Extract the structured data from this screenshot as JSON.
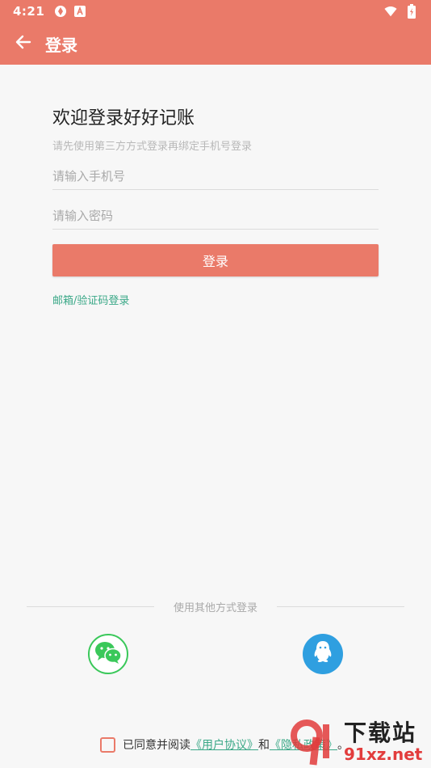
{
  "status_bar": {
    "time": "4:21",
    "left_icons": [
      "sync-icon",
      "font-a-icon"
    ],
    "right_icons": [
      "wifi-icon",
      "battery-icon"
    ]
  },
  "app_bar": {
    "back_icon": "arrow-left-icon",
    "title": "登录",
    "color": "#ea7a69"
  },
  "main": {
    "welcome_title": "欢迎登录好好记账",
    "welcome_subtitle": "请先使用第三方方式登录再绑定手机号登录",
    "phone_placeholder": "请输入手机号",
    "password_placeholder": "请输入密码",
    "login_button": "登录",
    "alt_login_link": "邮箱/验证码登录"
  },
  "other_login": {
    "divider_text": "使用其他方式登录",
    "options": [
      {
        "name": "wechat",
        "icon": "wechat-icon",
        "color": "#3ac85a"
      },
      {
        "name": "qq",
        "icon": "qq-icon",
        "color": "#2f9fe0"
      }
    ]
  },
  "agreement": {
    "prefix": "已同意并阅读",
    "user_agreement": "《用户协议》",
    "and": "和",
    "privacy_policy": "《隐私政策》",
    "suffix": "。"
  },
  "watermark": {
    "cn": "下载站",
    "en": "91xz.net"
  },
  "colors": {
    "accent": "#ea7a69",
    "link": "#3aa887"
  }
}
